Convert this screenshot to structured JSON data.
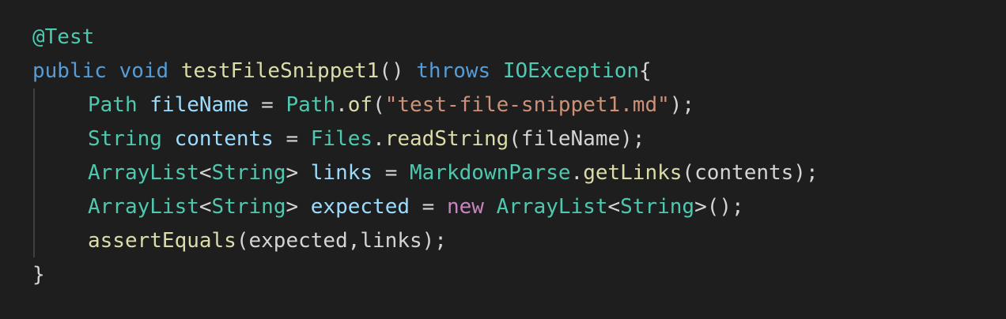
{
  "code_editor": {
    "lines": [
      {
        "tokens": [
          {
            "text": "@Test",
            "kind": "type"
          }
        ]
      },
      {
        "tokens": [
          {
            "text": "public",
            "kind": "kw"
          },
          {
            "text": " ",
            "kind": "plain"
          },
          {
            "text": "void",
            "kind": "kw"
          },
          {
            "text": " ",
            "kind": "plain"
          },
          {
            "text": "testFileSnippet1",
            "kind": "fn"
          },
          {
            "text": "() ",
            "kind": "plain"
          },
          {
            "text": "throws",
            "kind": "kw"
          },
          {
            "text": " ",
            "kind": "plain"
          },
          {
            "text": "IOException",
            "kind": "type"
          },
          {
            "text": "{",
            "kind": "plain"
          }
        ]
      },
      {
        "indent": true,
        "tokens": [
          {
            "text": "Path",
            "kind": "type"
          },
          {
            "text": " ",
            "kind": "plain"
          },
          {
            "text": "fileName",
            "kind": "var"
          },
          {
            "text": " = ",
            "kind": "plain"
          },
          {
            "text": "Path",
            "kind": "type"
          },
          {
            "text": ".",
            "kind": "plain"
          },
          {
            "text": "of",
            "kind": "fn"
          },
          {
            "text": "(",
            "kind": "plain"
          },
          {
            "text": "\"test-file-snippet1.md\"",
            "kind": "str"
          },
          {
            "text": ");",
            "kind": "plain"
          }
        ]
      },
      {
        "indent": true,
        "tokens": [
          {
            "text": "String",
            "kind": "type"
          },
          {
            "text": " ",
            "kind": "plain"
          },
          {
            "text": "contents",
            "kind": "var"
          },
          {
            "text": " = ",
            "kind": "plain"
          },
          {
            "text": "Files",
            "kind": "type"
          },
          {
            "text": ".",
            "kind": "plain"
          },
          {
            "text": "readString",
            "kind": "fn"
          },
          {
            "text": "(fileName);",
            "kind": "plain"
          }
        ]
      },
      {
        "indent": true,
        "tokens": [
          {
            "text": "ArrayList",
            "kind": "type"
          },
          {
            "text": "<",
            "kind": "plain"
          },
          {
            "text": "String",
            "kind": "type"
          },
          {
            "text": "> ",
            "kind": "plain"
          },
          {
            "text": "links",
            "kind": "var"
          },
          {
            "text": " = ",
            "kind": "plain"
          },
          {
            "text": "MarkdownParse",
            "kind": "type"
          },
          {
            "text": ".",
            "kind": "plain"
          },
          {
            "text": "getLinks",
            "kind": "fn"
          },
          {
            "text": "(contents);",
            "kind": "plain"
          }
        ]
      },
      {
        "indent": true,
        "tokens": [
          {
            "text": "ArrayList",
            "kind": "type"
          },
          {
            "text": "<",
            "kind": "plain"
          },
          {
            "text": "String",
            "kind": "type"
          },
          {
            "text": "> ",
            "kind": "plain"
          },
          {
            "text": "expected",
            "kind": "var"
          },
          {
            "text": " = ",
            "kind": "plain"
          },
          {
            "text": "new",
            "kind": "ctrl"
          },
          {
            "text": " ",
            "kind": "plain"
          },
          {
            "text": "ArrayList",
            "kind": "type"
          },
          {
            "text": "<",
            "kind": "plain"
          },
          {
            "text": "String",
            "kind": "type"
          },
          {
            "text": ">();",
            "kind": "plain"
          }
        ]
      },
      {
        "indent": true,
        "tokens": [
          {
            "text": "assertEquals",
            "kind": "fn"
          },
          {
            "text": "(expected,links);",
            "kind": "plain"
          }
        ]
      },
      {
        "tokens": [
          {
            "text": "}",
            "kind": "plain"
          }
        ]
      }
    ]
  }
}
